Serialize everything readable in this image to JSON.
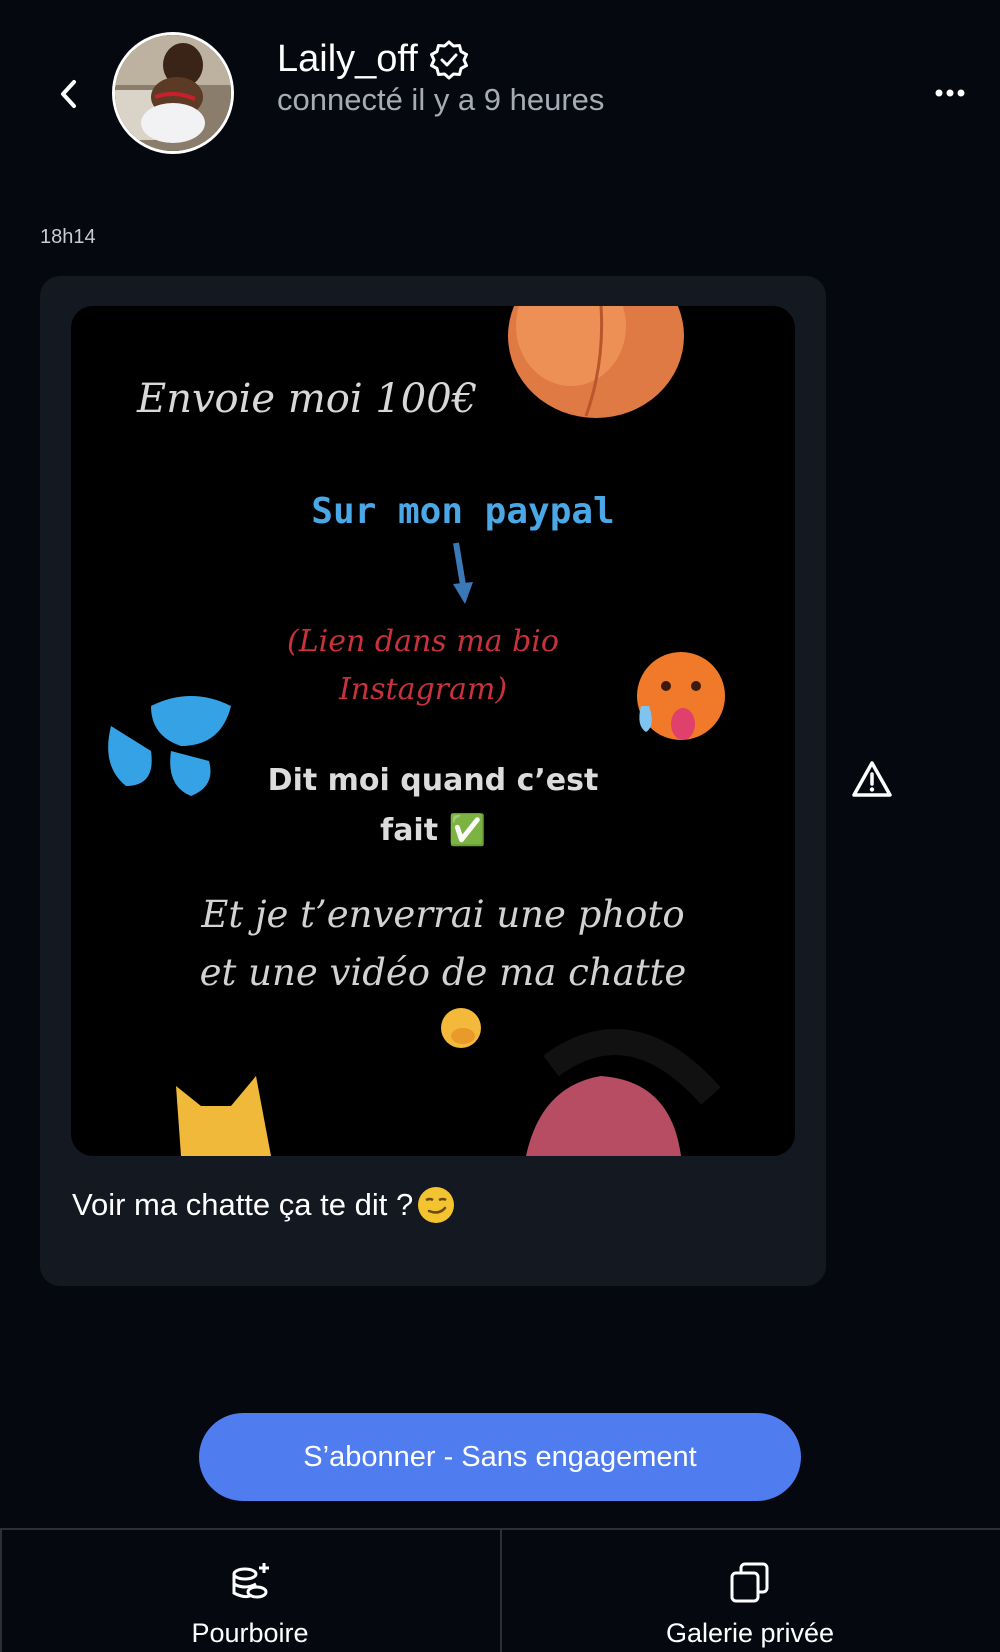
{
  "header": {
    "username": "Laily_off",
    "status": "connecté il y a 9 heures"
  },
  "message": {
    "timestamp": "18h14",
    "image_text": {
      "line1": "Envoie moi 100€",
      "line2": "Sur mon paypal",
      "line3a": "(Lien dans ma bio",
      "line3b": "Instagram)",
      "line4a": "Dit moi quand c’est",
      "line4b": "fait ✅",
      "line5a": "Et je t’enverrai une photo",
      "line5b": "et une vidéo de ma chatte",
      "emoji_hand": "🤭",
      "emoji_peach": "🍑",
      "emoji_hot": "🥵",
      "emoji_drops": "💦",
      "emoji_cat": "🐱"
    },
    "caption": "Voir ma chatte ça te dit ?",
    "caption_emoji": "😏"
  },
  "subscribe": {
    "label": "S’abonner - Sans engagement"
  },
  "bottom_nav": {
    "tip_label": "Pourboire",
    "gallery_label": "Galerie privée"
  },
  "colors": {
    "background": "#05080f",
    "bubble": "#131821",
    "accent": "#4f7df0",
    "muted_text": "#a6abb5"
  }
}
